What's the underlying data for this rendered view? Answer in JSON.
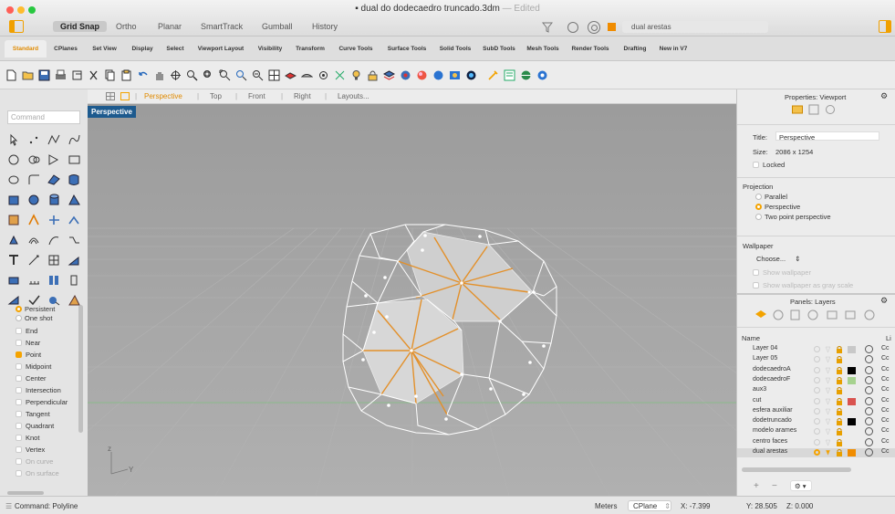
{
  "window": {
    "title": "dual do dodecaedro truncado.3dm",
    "edited": "— Edited"
  },
  "modes": [
    "Grid Snap",
    "Ortho",
    "Planar",
    "SmartTrack",
    "Gumball",
    "History"
  ],
  "current_layer": "dual arestas",
  "tabs": [
    "Standard",
    "CPlanes",
    "Set View",
    "Display",
    "Select",
    "Viewport Layout",
    "Visibility",
    "Transform",
    "Curve Tools",
    "Surface Tools",
    "Solid Tools",
    "SubD Tools",
    "Mesh Tools",
    "Render Tools",
    "Drafting",
    "New in V7"
  ],
  "command_placeholder": "Command",
  "osnaps": [
    {
      "label": "Persistent",
      "state": "radio-on"
    },
    {
      "label": "One shot",
      "state": "radio-off"
    },
    {
      "label": "End",
      "state": "off"
    },
    {
      "label": "Near",
      "state": "off"
    },
    {
      "label": "Point",
      "state": "on"
    },
    {
      "label": "Midpoint",
      "state": "off"
    },
    {
      "label": "Center",
      "state": "off"
    },
    {
      "label": "Intersection",
      "state": "off"
    },
    {
      "label": "Perpendicular",
      "state": "off"
    },
    {
      "label": "Tangent",
      "state": "off"
    },
    {
      "label": "Quadrant",
      "state": "off"
    },
    {
      "label": "Knot",
      "state": "off"
    },
    {
      "label": "Vertex",
      "state": "off"
    },
    {
      "label": "On curve",
      "state": "dim"
    },
    {
      "label": "On surface",
      "state": "dim"
    }
  ],
  "view_tabs": [
    "Perspective",
    "Top",
    "Front",
    "Right",
    "Layouts..."
  ],
  "viewport_label": "Perspective",
  "axis_labels": {
    "z": "z",
    "y": "Y"
  },
  "properties": {
    "header": "Properties: Viewport",
    "title_label": "Title:",
    "title_value": "Perspective",
    "size_label": "Size:",
    "size_value": "2086 x 1254",
    "locked": "Locked",
    "projection_header": "Projection",
    "projection_options": [
      {
        "label": "Parallel",
        "selected": false
      },
      {
        "label": "Perspective",
        "selected": true
      },
      {
        "label": "Two point perspective",
        "selected": false
      }
    ],
    "wallpaper_header": "Wallpaper",
    "wallpaper_choose": "Choose...",
    "wallpaper_show": "Show wallpaper",
    "wallpaper_gray": "Show wallpaper as gray scale"
  },
  "layers": {
    "header": "Panels: Layers",
    "name_col": "Name",
    "extra_col": "Li",
    "rows": [
      {
        "name": "Layer 04",
        "color": "#c8c8c8",
        "current": false
      },
      {
        "name": "Layer 05",
        "color": "",
        "current": false
      },
      {
        "name": "dodecaedroA",
        "color": "#000000",
        "current": false
      },
      {
        "name": "dodecaedroF",
        "color": "#a6d28f",
        "current": false
      },
      {
        "name": "aux3",
        "color": "",
        "current": false
      },
      {
        "name": "cut",
        "color": "#d9534f",
        "current": false
      },
      {
        "name": "esfera auxiliar",
        "color": "",
        "current": false
      },
      {
        "name": "dodetruncado",
        "color": "#000000",
        "current": false
      },
      {
        "name": "modelo arames",
        "color": "",
        "current": false
      },
      {
        "name": "centro faces",
        "color": "",
        "current": false
      },
      {
        "name": "dual arestas",
        "color": "#f08c00",
        "current": true
      }
    ],
    "row_suffix": "Cc"
  },
  "status": {
    "command": "Command: Polyline",
    "units": "Meters",
    "cplane": "CPlane",
    "x": "X: -7.399",
    "y": "Y: 28.505",
    "z": "Z: 0.000"
  },
  "colors": {
    "accent": "#f5a300",
    "viewport": "#a4a4a4",
    "label": "#1d5a8e"
  }
}
